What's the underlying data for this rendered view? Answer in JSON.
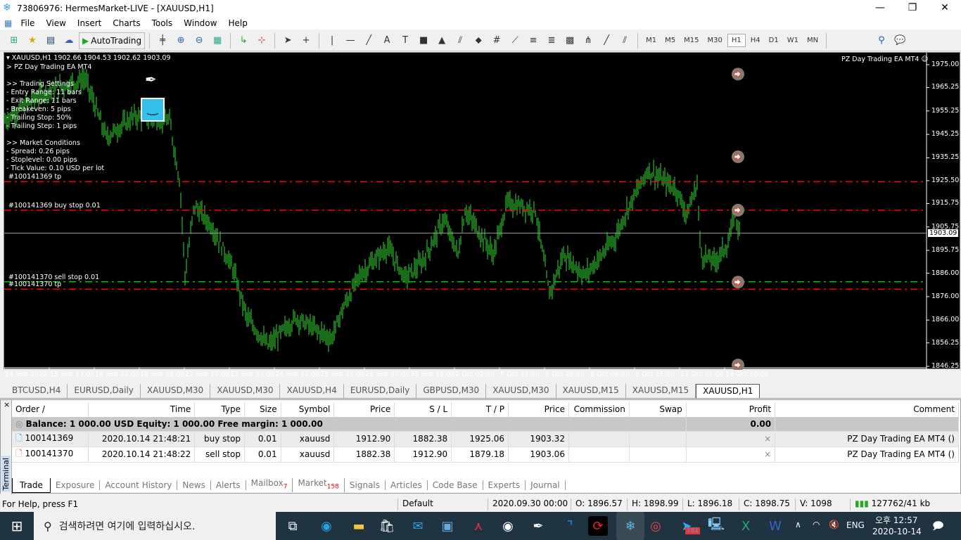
{
  "window": {
    "title": "73806976: HermesMarket-LIVE - [XAUUSD,H1]",
    "minimize": "—",
    "restore": "❐",
    "close": "✕"
  },
  "menu": [
    "File",
    "View",
    "Insert",
    "Charts",
    "Tools",
    "Window",
    "Help"
  ],
  "toolbar": {
    "autotrading": "AutoTrading",
    "timeframes": [
      "M1",
      "M5",
      "M15",
      "M30",
      "H1",
      "H4",
      "D1",
      "W1",
      "MN"
    ],
    "active_timeframe": "H1"
  },
  "chart": {
    "header": "XAUUSD,H1  1902.66 1904.53 1902.62 1903.09",
    "ea_name": "> PZ Day Trading EA MT4",
    "ea_label_right": "PZ Day Trading EA MT4",
    "settings": [
      ">> Trading Settings",
      "- Entry Range: 11 bars",
      "- Exit Range: 11 bars",
      "- Breakeven: 5 pips",
      "- Trailing Stop: 50%",
      "- Trailing Step: 1 pips",
      "",
      ">> Market Conditions",
      "- Spread: 0.26 pips",
      "- Stoplevel: 0.00 pips",
      "- Tick Value: 0.10 USD per lot"
    ],
    "price_ticks": [
      "1975.00",
      "1965.25",
      "1955.25",
      "1945.25",
      "1935.25",
      "1925.50",
      "1915.75",
      "1905.75",
      "1895.75",
      "1886.00",
      "1876.00",
      "1866.00",
      "1856.25",
      "1846.25"
    ],
    "price_range": [
      1846.25,
      1975.0
    ],
    "current_price": "1903.09",
    "time_labels": [
      "14 Sep 2020",
      "15 Sep 13:00",
      "16 Sep 22:00",
      "18 Sep 08:00",
      "21 Sep 17:00",
      "23 Sep 03:00",
      "24 Sep 12:00",
      "25 Sep 21:00",
      "29 Sep 07:00",
      "30 Sep 16:00",
      "2 Oct 02:00",
      "5 Oct 11:00",
      "6 Oct 20:00",
      "8 Oct 06:00",
      "9 Oct 15:00",
      "13 Oct 01:00",
      "14 Oct 10:00"
    ],
    "levels": [
      {
        "label": "#100141369 tp",
        "price": 1925.06,
        "color": "#ff0000"
      },
      {
        "label": "#100141369 buy stop 0.01",
        "price": 1912.9,
        "color": "#ff0000"
      },
      {
        "label": "",
        "price": 1903.09,
        "color": "#a0a0a0"
      },
      {
        "label": "#100141370 sell stop 0.01",
        "price": 1882.38,
        "color": "#00cc00"
      },
      {
        "label": "#100141370 tp",
        "price": 1879.18,
        "color": "#ff0000"
      }
    ],
    "bar_color": "#33dd33"
  },
  "chart_tabs": [
    "BTCUSD,H4",
    "EURUSD,Daily",
    "XAUUSD,M30",
    "XAUUSD,M30",
    "XAUUSD,H4",
    "EURUSD,Daily",
    "GBPUSD,M30",
    "XAUUSD,M30",
    "XAUUSD,M15",
    "XAUUSD,M15",
    "XAUUSD,H1"
  ],
  "terminal": {
    "label": "Terminal",
    "columns": [
      "Order  /",
      "Time",
      "Type",
      "Size",
      "Symbol",
      "Price",
      "S / L",
      "T / P",
      "Price",
      "Commission",
      "Swap",
      "Profit",
      "Comment"
    ],
    "balance": "Balance: 1 000.00 USD  Equity: 1 000.00  Free margin: 1 000.00",
    "balance_profit": "0.00",
    "rows": [
      {
        "order": "100141369",
        "time": "2020.10.14 21:48:21",
        "type": "buy stop",
        "size": "0.01",
        "symbol": "xauusd",
        "price": "1912.90",
        "sl": "1882.38",
        "tp": "1925.06",
        "cur": "1903.32",
        "close": "×",
        "comment": "PZ Day Trading EA MT4 ()"
      },
      {
        "order": "100141370",
        "time": "2020.10.14 21:48:22",
        "type": "sell stop",
        "size": "0.01",
        "symbol": "xauusd",
        "price": "1882.38",
        "sl": "1912.90",
        "tp": "1879.18",
        "cur": "1903.06",
        "close": "×",
        "comment": "PZ Day Trading EA MT4 ()"
      }
    ],
    "tabs": [
      {
        "label": "Trade"
      },
      {
        "label": "Exposure"
      },
      {
        "label": "Account History"
      },
      {
        "label": "News"
      },
      {
        "label": "Alerts"
      },
      {
        "label": "Mailbox",
        "badge": "7"
      },
      {
        "label": "Market",
        "badge": "158"
      },
      {
        "label": "Signals"
      },
      {
        "label": "Articles"
      },
      {
        "label": "Code Base"
      },
      {
        "label": "Experts"
      },
      {
        "label": "Journal"
      }
    ]
  },
  "status": {
    "help": "For Help, press F1",
    "profile": "Default",
    "datetime": "2020.09.30 00:00",
    "open": "O: 1896.57",
    "high": "H: 1898.99",
    "low": "L: 1896.18",
    "close": "C: 1898.75",
    "volume": "V: 1098",
    "traffic": "127762/41 kb"
  },
  "taskbar": {
    "search_placeholder": "검색하려면 여기에 입력하십시오.",
    "telegram_badge": "181",
    "lang": "ENG",
    "time": "오후 12:57",
    "date": "2020-10-14"
  }
}
